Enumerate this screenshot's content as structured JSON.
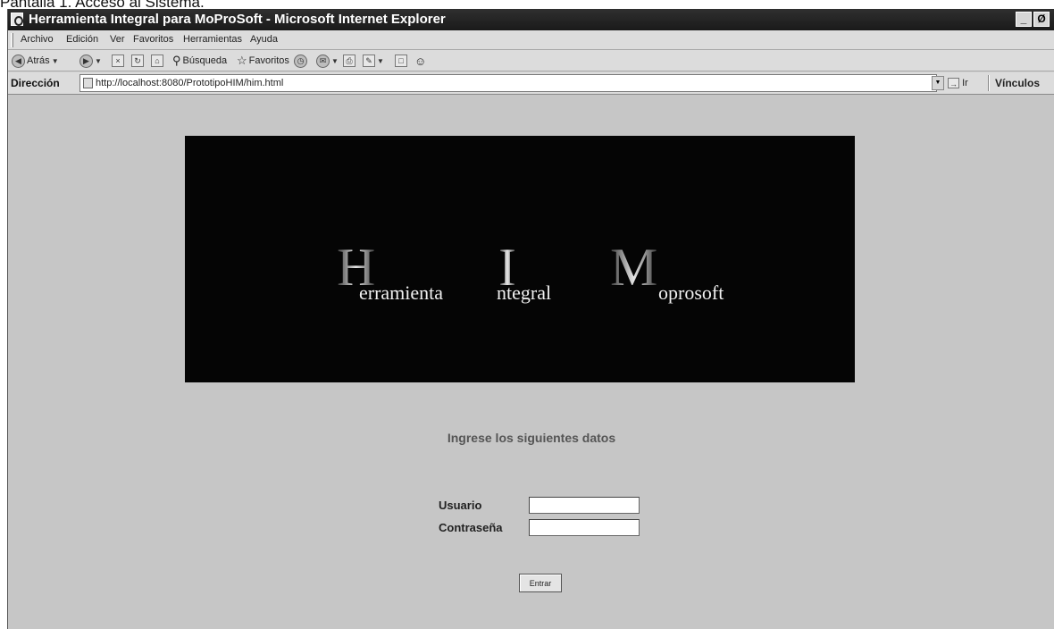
{
  "caption": "Pantalla 1. Acceso al Sistema.",
  "window": {
    "title": "Herramienta Integral para MoProSoft - Microsoft Internet Explorer",
    "minimize_glyph": "_",
    "restore_glyph": "Ø"
  },
  "menu": [
    "Archivo",
    "Edición",
    "Ver",
    "Favoritos",
    "Herramientas",
    "Ayuda"
  ],
  "toolbar": {
    "back_label": "Atrás",
    "search_label": "Búsqueda",
    "favorites_label": "Favoritos"
  },
  "address": {
    "label": "Dirección",
    "url": "http://localhost:8080/PrototipoHIM/him.html",
    "go_label": "Ir",
    "links_label": "Vínculos"
  },
  "banner": {
    "letter1": "H",
    "word1": "erramienta",
    "letter2": "I",
    "word2": "ntegral",
    "letter3": "M",
    "word3": "oprosoft"
  },
  "form": {
    "prompt": "Ingrese los siguientes datos",
    "user_label": "Usuario",
    "password_label": "Contraseña",
    "user_value": "",
    "password_value": "",
    "submit_label": "Entrar"
  },
  "colors": {
    "titlebar": "#1a1a1a",
    "content_bg": "#c6c6c6",
    "banner_bg": "#050505",
    "prompt_text": "#555555"
  },
  "icons": [
    "ie-page-icon",
    "back-icon",
    "forward-icon",
    "stop-icon",
    "refresh-icon",
    "home-icon",
    "search-icon",
    "favorites-star-icon",
    "history-icon",
    "mail-icon",
    "print-icon",
    "edit-icon",
    "messenger-icon"
  ]
}
